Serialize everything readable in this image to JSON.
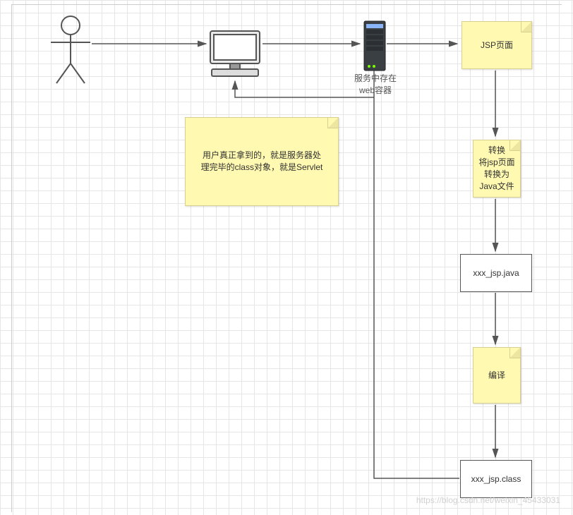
{
  "diagram": {
    "server_label_line1": "服务中存在",
    "server_label_line2": "web容器",
    "note_main_line1": "用户真正拿到的，就是服务器处",
    "note_main_line2": "理完毕的class对象，就是Servlet",
    "jsp_page": "JSP页面",
    "convert_title": "转换",
    "convert_line1": "将jsp页面",
    "convert_line2": "转换为",
    "convert_line3": "Java文件",
    "java_file": "xxx_jsp.java",
    "compile": "编译",
    "class_file": "xxx_jsp.class",
    "watermark": "https://blog.csdn.net/weixin_45433031"
  }
}
